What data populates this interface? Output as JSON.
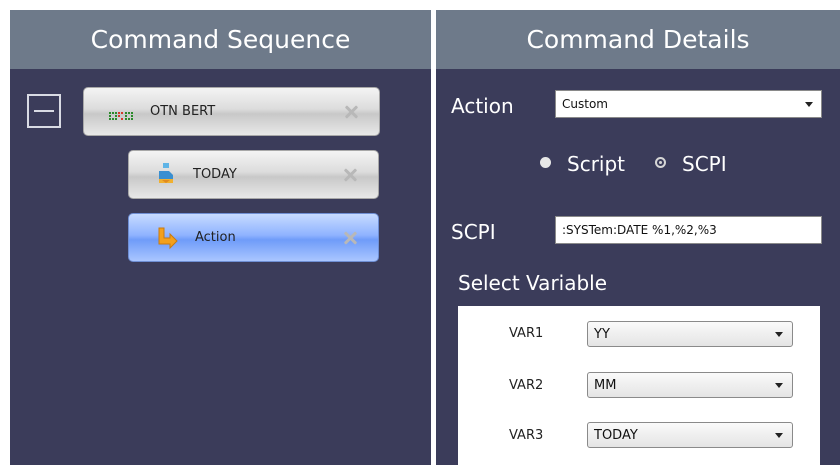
{
  "sequence_panel": {
    "title": "Command Sequence",
    "nodes": [
      {
        "label": "OTN BERT",
        "icon": "otn-bert-icon"
      },
      {
        "label": "TODAY",
        "icon": "today-command-icon"
      },
      {
        "label": "Action",
        "icon": "action-arrow-icon",
        "selected": true
      }
    ]
  },
  "details_panel": {
    "title": "Command Details",
    "action_label": "Action",
    "action_value": "Custom",
    "radio_script_label": "Script",
    "radio_scpi_label": "SCPI",
    "selected_mode": "SCPI",
    "scpi_label": "SCPI",
    "scpi_value": ":SYSTem:DATE %1,%2,%3",
    "select_variable_label": "Select Variable",
    "variables": [
      {
        "name": "VAR1",
        "value": "YY"
      },
      {
        "name": "VAR2",
        "value": "MM"
      },
      {
        "name": "VAR3",
        "value": "TODAY"
      }
    ]
  },
  "colors": {
    "header_bg": "#6e7a8a",
    "panel_bg": "#3b3c5a",
    "selected_node": "#8fb3ff"
  }
}
